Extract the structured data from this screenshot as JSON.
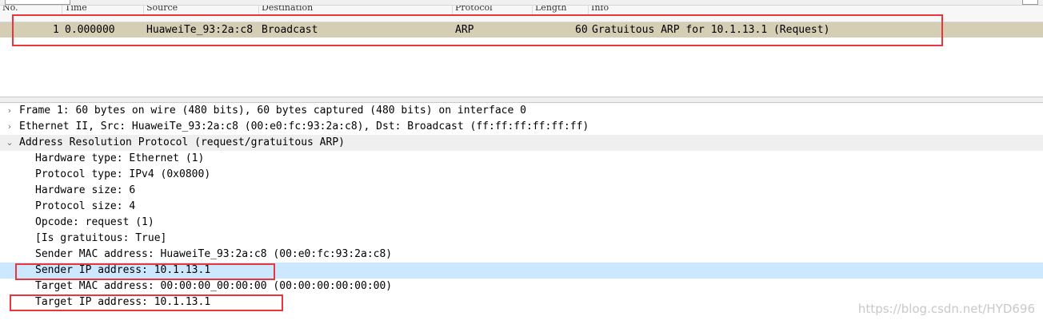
{
  "packet_list": {
    "columns": [
      "No.",
      "Time",
      "Source",
      "Destination",
      "Protocol",
      "Length",
      "Info"
    ],
    "rows": [
      {
        "no": "1",
        "time": "0.000000",
        "source": "HuaweiTe_93:2a:c8",
        "destination": "Broadcast",
        "protocol": "ARP",
        "length": "60",
        "info": "Gratuitous ARP for 10.1.13.1 (Request)"
      }
    ]
  },
  "details": {
    "items": [
      {
        "label": "Frame 1: 60 bytes on wire (480 bits), 60 bytes captured (480 bits) on interface 0",
        "state": "collapsed"
      },
      {
        "label": "Ethernet II, Src: HuaweiTe_93:2a:c8 (00:e0:fc:93:2a:c8), Dst: Broadcast (ff:ff:ff:ff:ff:ff)",
        "state": "collapsed"
      },
      {
        "label": "Address Resolution Protocol (request/gratuitous ARP)",
        "state": "expanded"
      },
      {
        "label": "Hardware type: Ethernet (1)"
      },
      {
        "label": "Protocol type: IPv4 (0x0800)"
      },
      {
        "label": "Hardware size: 6"
      },
      {
        "label": "Protocol size: 4"
      },
      {
        "label": "Opcode: request (1)"
      },
      {
        "label": "[Is gratuitous: True]"
      },
      {
        "label": "Sender MAC address: HuaweiTe_93:2a:c8 (00:e0:fc:93:2a:c8)"
      },
      {
        "label": "Sender IP address: 10.1.13.1",
        "selected": true
      },
      {
        "label": "Target MAC address: 00:00:00_00:00:00 (00:00:00:00:00:00)"
      },
      {
        "label": "Target IP address: 10.1.13.1"
      }
    ]
  },
  "icons": {
    "collapsed": "chevron-right-icon",
    "expanded": "chevron-down-icon"
  },
  "colors": {
    "packet_row_bg": "#d6ceb4",
    "selected_row_bg": "#cce8ff",
    "annotation": "#e8353e"
  },
  "watermark": "https://blog.csdn.net/HYD696"
}
